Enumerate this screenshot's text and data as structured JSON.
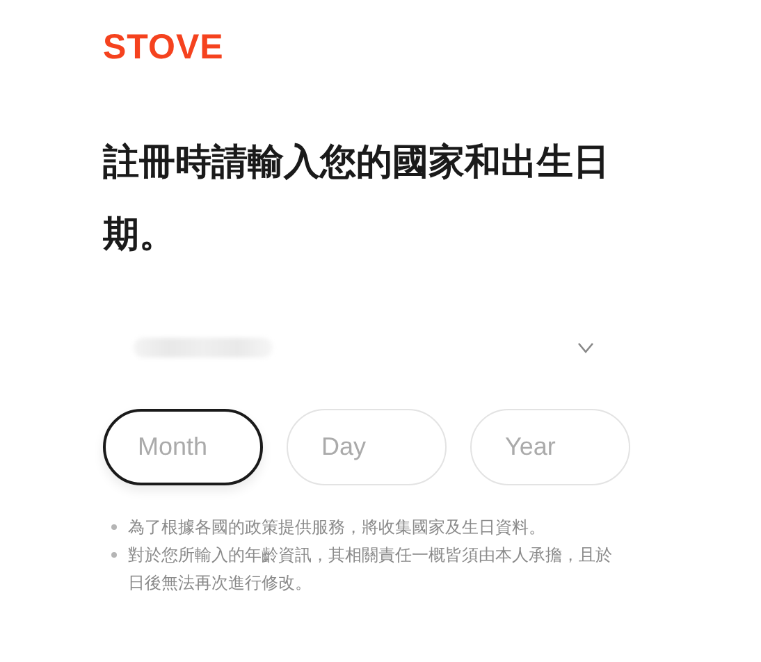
{
  "logo": "STOVE",
  "heading": "註冊時請輸入您的國家和出生日期。",
  "country_select": {
    "value_blurred": true,
    "expanded": false
  },
  "birth_date_fields": [
    {
      "placeholder": "Month",
      "focused": true
    },
    {
      "placeholder": "Day",
      "focused": false
    },
    {
      "placeholder": "Year",
      "focused": false
    }
  ],
  "notes": [
    "為了根據各國的政策提供服務，將收集國家及生日資料。",
    "對於您所輸入的年齡資訊，其相關責任一概皆須由本人承擔，且於日後無法再次進行修改。"
  ]
}
